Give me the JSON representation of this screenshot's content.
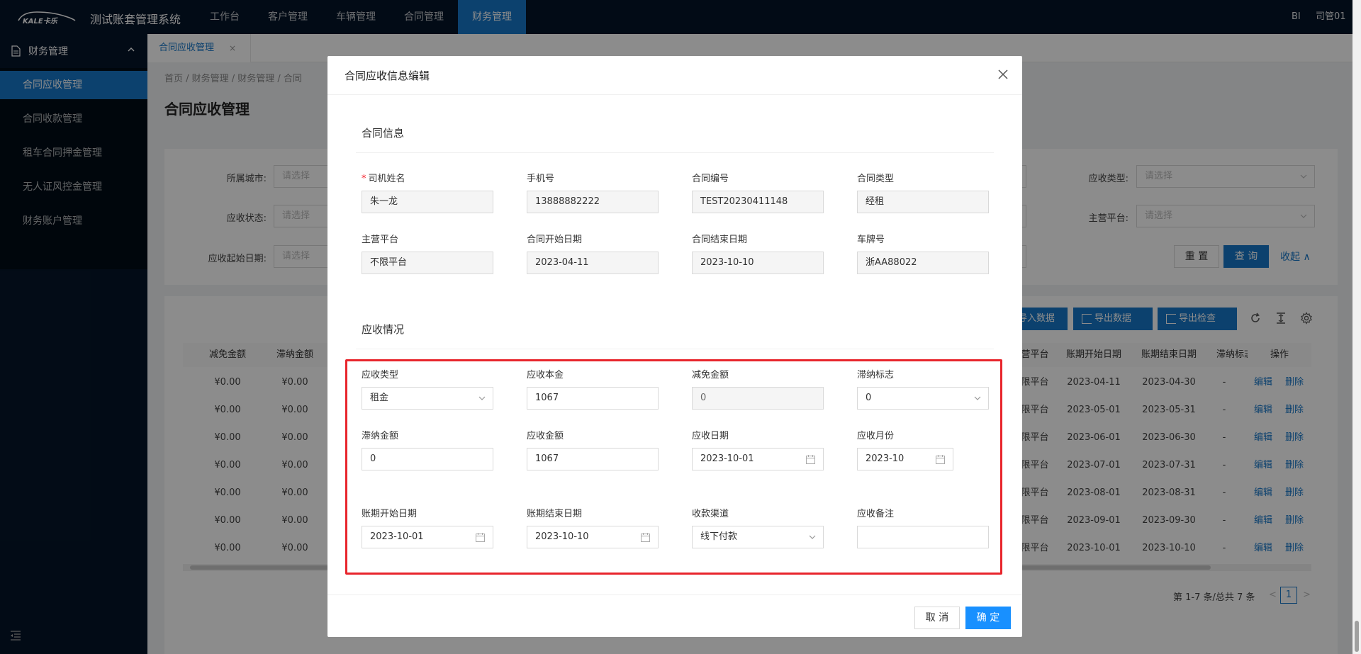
{
  "app": {
    "logo_text": "KALE卡乐",
    "title": "测试账套管理系统"
  },
  "nav": {
    "items": [
      {
        "label": "工作台"
      },
      {
        "label": "客户管理"
      },
      {
        "label": "车辆管理"
      },
      {
        "label": "合同管理"
      },
      {
        "label": "财务管理",
        "active": true
      }
    ],
    "bi": "BI",
    "user": "司管01"
  },
  "sidebar": {
    "group": "财务管理",
    "items": [
      {
        "label": "合同应收管理",
        "active": true
      },
      {
        "label": "合同收款管理"
      },
      {
        "label": "租车合同押金管理"
      },
      {
        "label": "无人证风控金管理"
      },
      {
        "label": "财务账户管理"
      }
    ]
  },
  "tabs": [
    {
      "label": "合同应收管理",
      "close": "×"
    }
  ],
  "breadcrumb": "首页 / 财务管理 / 财务管理 / 合同",
  "page_title": "合同应收管理",
  "filters": {
    "city_label": "所属城市:",
    "city_placeholder": "请选择",
    "status_label": "应收状态:",
    "status_placeholder": "请选择",
    "start_date_label": "应收起始日期:",
    "start_date_placeholder": "请选择",
    "type_label": "应收类型:",
    "type_placeholder": "请选择",
    "platform_label": "主营平台:",
    "platform_placeholder": "请选择",
    "reset": "重 置",
    "query": "查 询",
    "collapse": "收起 ∧"
  },
  "toolbar": {
    "import": "导入数据",
    "export": "导出数据",
    "export_check": "导出检查"
  },
  "table": {
    "left_headers": [
      "减免金额",
      "滞纳金额"
    ],
    "right_headers": [
      "营平台",
      "账期开始日期",
      "账期结束日期",
      "滞纳标志",
      "操作"
    ],
    "rows": [
      {
        "jm": "¥0.00",
        "zn": "¥0.00",
        "pt": "限平台",
        "start": "2023-04-11",
        "end": "2023-04-30",
        "flag": "-",
        "edit": "编辑",
        "del": "删除"
      },
      {
        "jm": "¥0.00",
        "zn": "¥0.00",
        "pt": "限平台",
        "start": "2023-05-01",
        "end": "2023-05-31",
        "flag": "-",
        "edit": "编辑",
        "del": "删除"
      },
      {
        "jm": "¥0.00",
        "zn": "¥0.00",
        "pt": "限平台",
        "start": "2023-06-01",
        "end": "2023-06-30",
        "flag": "-",
        "edit": "编辑",
        "del": "删除"
      },
      {
        "jm": "¥0.00",
        "zn": "¥0.00",
        "pt": "限平台",
        "start": "2023-07-01",
        "end": "2023-07-31",
        "flag": "-",
        "edit": "编辑",
        "del": "删除"
      },
      {
        "jm": "¥0.00",
        "zn": "¥0.00",
        "pt": "限平台",
        "start": "2023-08-01",
        "end": "2023-08-31",
        "flag": "-",
        "edit": "编辑",
        "del": "删除"
      },
      {
        "jm": "¥0.00",
        "zn": "¥0.00",
        "pt": "限平台",
        "start": "2023-09-01",
        "end": "2023-09-30",
        "flag": "-",
        "edit": "编辑",
        "del": "删除"
      },
      {
        "jm": "¥0.00",
        "zn": "¥0.00",
        "pt": "限平台",
        "start": "2023-10-01",
        "end": "2023-10-10",
        "flag": "-",
        "edit": "编辑",
        "del": "删除"
      }
    ]
  },
  "pagination": {
    "summary": "第 1-7 条/总共 7 条",
    "prev": "<",
    "page": "1",
    "next": ">"
  },
  "modal": {
    "title": "合同应收信息编辑",
    "close": "×",
    "section1": "合同信息",
    "driver_name_label": "司机姓名",
    "required_mark": "*",
    "driver_name": "朱一龙",
    "phone_label": "手机号",
    "phone": "13888882222",
    "contract_no_label": "合同编号",
    "contract_no": "TEST20230411148",
    "contract_type_label": "合同类型",
    "contract_type": "经租",
    "platform_label": "主营平台",
    "platform": "不限平台",
    "contract_start_label": "合同开始日期",
    "contract_start": "2023-04-11",
    "contract_end_label": "合同结束日期",
    "contract_end": "2023-10-10",
    "plate_label": "车牌号",
    "plate": "浙AA88022",
    "section2": "应收情况",
    "recv_type_label": "应收类型",
    "recv_type": "租金",
    "principal_label": "应收本金",
    "principal": "1067",
    "waiver_label": "减免金额",
    "waiver": "0",
    "late_flag_label": "滞纳标志",
    "late_flag": "0",
    "late_amount_label": "滞纳金额",
    "late_amount": "0",
    "recv_amount_label": "应收金额",
    "recv_amount": "1067",
    "recv_date_label": "应收日期",
    "recv_date": "2023-10-01",
    "recv_month_label": "应收月份",
    "recv_month": "2023-10",
    "period_start_label": "账期开始日期",
    "period_start": "2023-10-01",
    "period_end_label": "账期结束日期",
    "period_end": "2023-10-10",
    "channel_label": "收款渠道",
    "channel": "线下付款",
    "remark_label": "应收备注",
    "remark": "",
    "cancel": "取 消",
    "ok": "确 定"
  },
  "colors": {
    "nav_bg": "#051529",
    "accent": "#1677c8",
    "primary_btn": "#1890ff",
    "highlight": "#e8252c"
  }
}
